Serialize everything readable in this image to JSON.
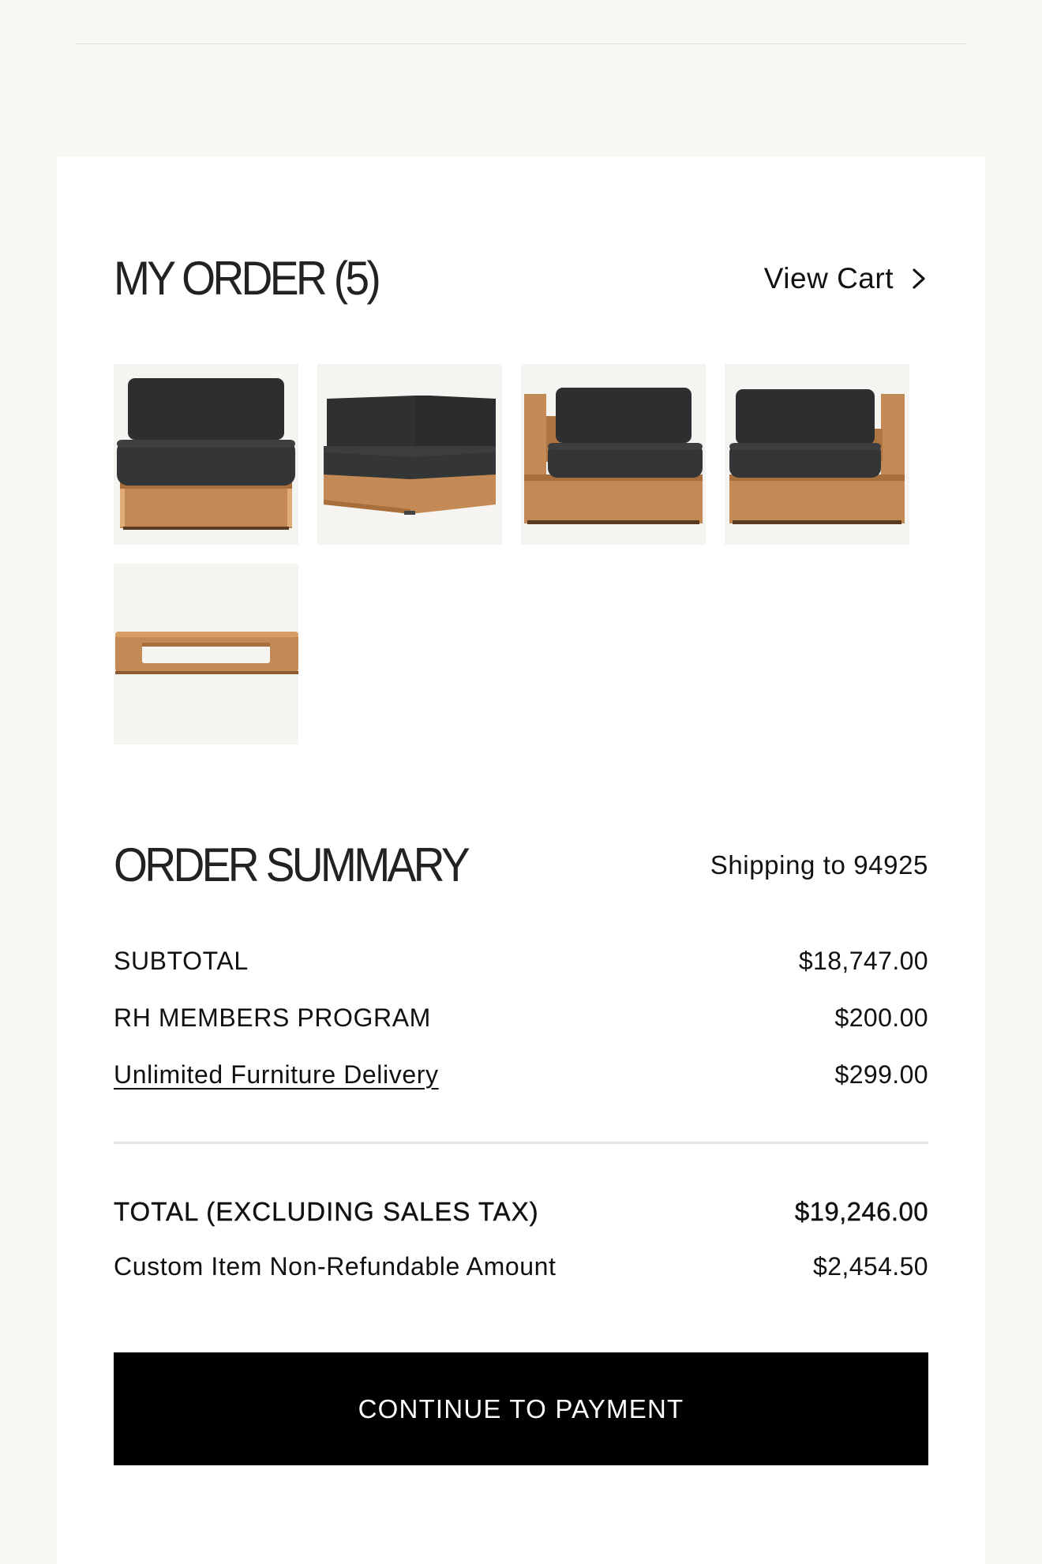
{
  "order": {
    "title": "MY ORDER (5)",
    "view_cart_label": "View Cart",
    "items": [
      {
        "name": "armless-chair-sectional"
      },
      {
        "name": "corner-sectional"
      },
      {
        "name": "left-arm-chair-sectional"
      },
      {
        "name": "right-arm-chair-sectional"
      },
      {
        "name": "teak-coffee-table"
      }
    ]
  },
  "summary": {
    "title": "ORDER SUMMARY",
    "shipping_text": "Shipping to 94925",
    "subtotal_label": "SUBTOTAL",
    "subtotal_value": "$18,747.00",
    "members_label": "RH MEMBERS PROGRAM",
    "members_value": "$200.00",
    "delivery_label": "Unlimited Furniture Delivery",
    "delivery_value": "$299.00",
    "total_label": "TOTAL (EXCLUDING SALES TAX)",
    "total_value": "$19,246.00",
    "custom_label": "Custom Item Non-Refundable Amount",
    "custom_value": "$2,454.50"
  },
  "cta": {
    "label": "CONTINUE TO PAYMENT"
  },
  "colors": {
    "page_bg": "#f8f7f4",
    "card_bg": "#ffffff",
    "cushion": "#2b2d2e",
    "teak": "#c48a55",
    "button_bg": "#000000"
  }
}
